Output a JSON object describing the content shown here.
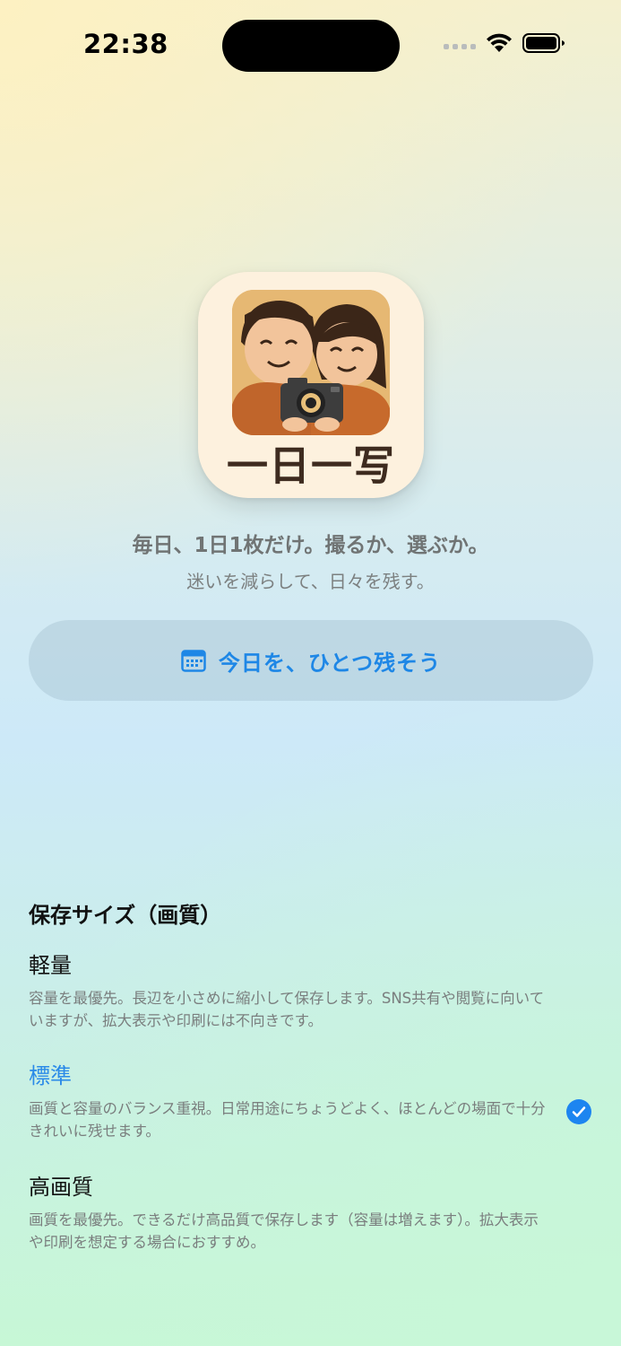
{
  "status_bar": {
    "time": "22:38"
  },
  "app": {
    "icon_title": "一日一写",
    "tagline": "毎日、1日1枚だけ。撮るか、選ぶか。",
    "subtagline": "迷いを減らして、日々を残す。"
  },
  "primary_action": {
    "label": "今日を、ひとつ残そう",
    "icon": "calendar-icon",
    "color": "#1e87e6"
  },
  "settings": {
    "section_title": "保存サイズ（画質）",
    "options": [
      {
        "title": "軽量",
        "description": "容量を最優先。長辺を小さめに縮小して保存します。SNS共有や閲覧に向いていますが、拡大表示や印刷には不向きです。",
        "selected": false
      },
      {
        "title": "標準",
        "description": "画質と容量のバランス重視。日常用途にちょうどよく、ほとんどの場面で十分きれいに残せます。",
        "selected": true
      },
      {
        "title": "高画質",
        "description": "画質を最優先。できるだけ高品質で保存します（容量は増えます）。拡大表示や印刷を想定する場合におすすめ。",
        "selected": false
      }
    ],
    "accent_color": "#2a8ae8"
  }
}
